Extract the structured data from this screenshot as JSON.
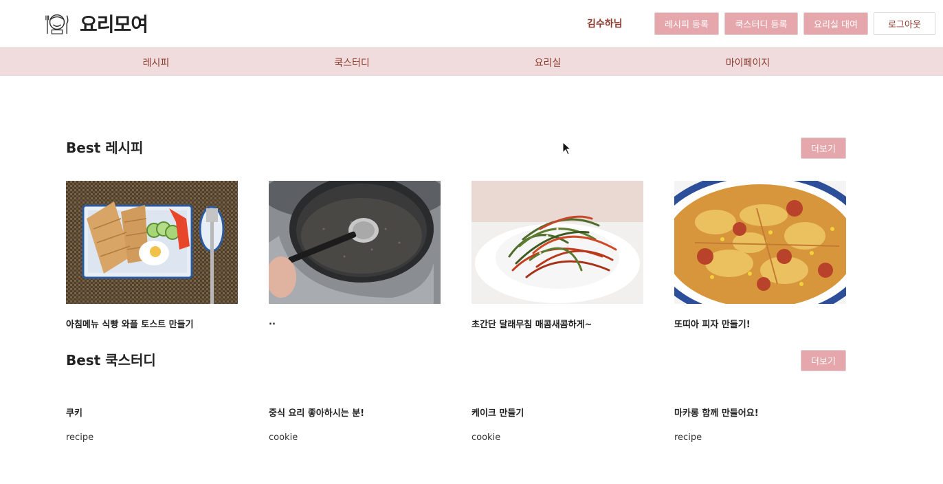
{
  "header": {
    "logo_text": "요리모여",
    "username": "김수하님",
    "buttons": {
      "recipe_register": "레시피 등록",
      "cookstudy_register": "쿡스터디 등록",
      "kitchen_rent": "요리실 대여",
      "logout": "로그아웃"
    }
  },
  "nav": {
    "items": [
      "레시피",
      "쿡스터디",
      "요리실",
      "마이페이지"
    ]
  },
  "best_recipes": {
    "title": "Best 레시피",
    "more_label": "더보기",
    "items": [
      {
        "title": "아침메뉴 식빵 와플 토스트 만들기"
      },
      {
        "title": ".."
      },
      {
        "title": "초간단 달래무침 매콤새콤하게~"
      },
      {
        "title": "또띠아 피자 만들기!"
      }
    ]
  },
  "best_studies": {
    "title": "Best 쿡스터디",
    "more_label": "더보기",
    "items": [
      {
        "title": "쿠키",
        "category": "recipe"
      },
      {
        "title": "중식 요리 좋아하시는 분!",
        "category": "cookie"
      },
      {
        "title": "케이크 만들기",
        "category": "cookie"
      },
      {
        "title": "마카롱 함께 만들어요!",
        "category": "recipe"
      }
    ]
  },
  "colors": {
    "accent_pink": "#e5a6ac",
    "nav_bg": "#f1dcdd",
    "text_brown": "#8b3b2e"
  }
}
